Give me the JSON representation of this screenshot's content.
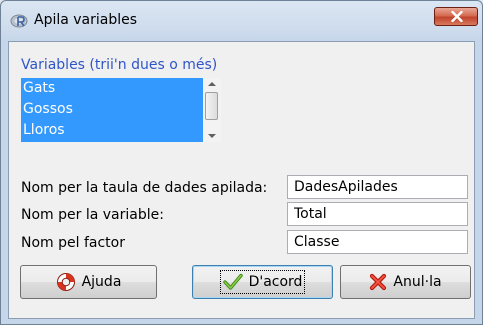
{
  "window": {
    "title": "Apila variables",
    "close_icon": "close-icon"
  },
  "variables": {
    "label": "Variables (trii'n dues o més)",
    "items": [
      "Gats",
      "Gossos",
      "Lloros"
    ]
  },
  "fields": [
    {
      "label": "Nom per la taula de dades apilada:",
      "value": "DadesApilades"
    },
    {
      "label": "Nom per la variable:",
      "value": "Total"
    },
    {
      "label": "Nom pel factor",
      "value": "Classe"
    }
  ],
  "buttons": {
    "help": {
      "label": "Ajuda",
      "icon": "lifebuoy-icon"
    },
    "ok": {
      "label": "D'acord",
      "icon": "checkmark-icon"
    },
    "cancel": {
      "label": "Anul·la",
      "icon": "red-x-icon"
    }
  },
  "colors": {
    "selection": "#3399ff",
    "label_blue": "#2f55c8",
    "close_red": "#c0442c"
  }
}
